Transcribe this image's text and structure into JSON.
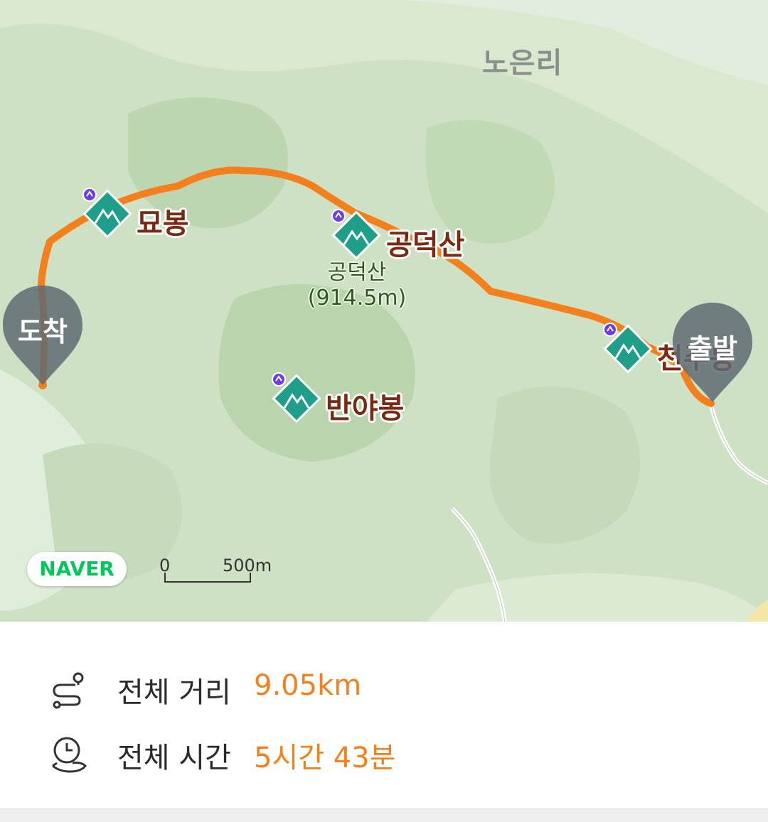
{
  "map": {
    "village_label": "노은리",
    "peaks": [
      {
        "name": "묘봉"
      },
      {
        "name": "공덕산",
        "sub_name": "공덕산",
        "elevation": "(914.5m)"
      },
      {
        "name": "천주봉"
      },
      {
        "name": "반야봉"
      }
    ],
    "pins": {
      "end_label": "도착",
      "start_label": "출발"
    },
    "brand": "NAVER",
    "scale": {
      "zero": "0",
      "distance": "500m"
    },
    "colors": {
      "route": "#f3801c",
      "peak_marker": "#1f9e8a",
      "pin": "#5f6b72",
      "brand": "#03c75a"
    }
  },
  "summary": {
    "distance": {
      "label": "전체 거리",
      "value": "9.05km",
      "icon": "route-icon"
    },
    "time": {
      "label": "전체 시간",
      "value": "5시간 43분",
      "icon": "clock-icon"
    }
  }
}
